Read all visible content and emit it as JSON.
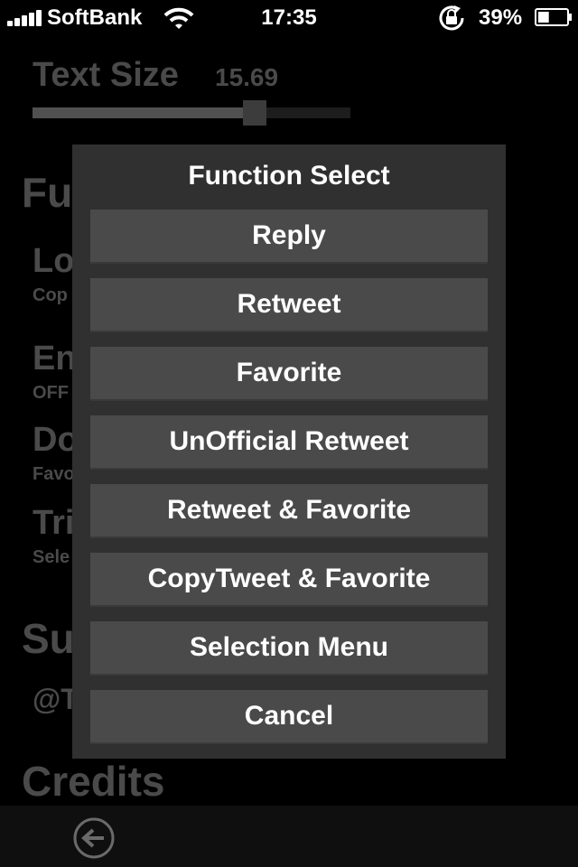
{
  "status_bar": {
    "carrier": "SoftBank",
    "time": "17:35",
    "battery_percent": "39%",
    "battery_level": 0.39,
    "signal_bars": 5
  },
  "settings": {
    "text_size": {
      "label": "Text Size",
      "value": "15.69",
      "slider_fraction": 0.7
    },
    "function_section_title": "Fu",
    "items": [
      {
        "title": "Lo",
        "subtitle": "Cop"
      },
      {
        "title": "En",
        "subtitle": "OFF"
      },
      {
        "title": "Do",
        "subtitle": "Favo"
      },
      {
        "title": "Tri",
        "subtitle": "Sele"
      }
    ],
    "support_section_title": "Su",
    "support_handle": "@T",
    "credits_section_title": "Credits"
  },
  "dialog": {
    "title": "Function Select",
    "buttons": [
      "Reply",
      "Retweet",
      "Favorite",
      "UnOfficial Retweet",
      "Retweet & Favorite",
      "CopyTweet & Favorite",
      "Selection Menu",
      "Cancel"
    ]
  },
  "toolbar": {
    "back_icon": "back-arrow-circle-icon"
  }
}
